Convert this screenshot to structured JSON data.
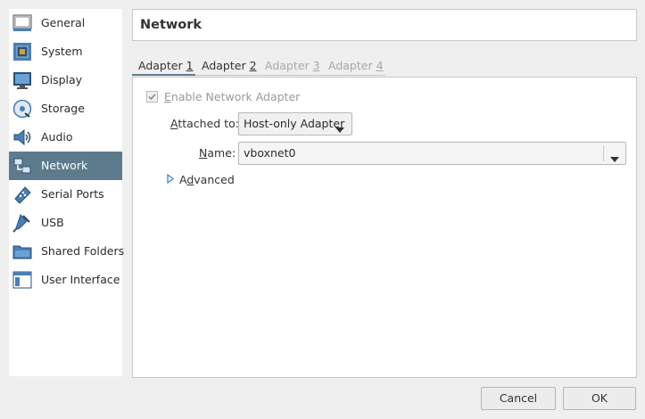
{
  "sidebar": {
    "items": [
      {
        "label": "General",
        "icon": "general-icon"
      },
      {
        "label": "System",
        "icon": "chip-icon"
      },
      {
        "label": "Display",
        "icon": "monitor-icon"
      },
      {
        "label": "Storage",
        "icon": "disk-icon"
      },
      {
        "label": "Audio",
        "icon": "speaker-icon"
      },
      {
        "label": "Network",
        "icon": "network-icon",
        "selected": true
      },
      {
        "label": "Serial Ports",
        "icon": "serial-port-icon"
      },
      {
        "label": "USB",
        "icon": "usb-icon"
      },
      {
        "label": "Shared Folders",
        "icon": "folder-icon"
      },
      {
        "label": "User Interface",
        "icon": "window-icon"
      }
    ]
  },
  "header": {
    "title": "Network"
  },
  "tabs": [
    {
      "prefix": "Adapter ",
      "mnemonic": "1",
      "enabled": true,
      "active": true
    },
    {
      "prefix": "Adapter ",
      "mnemonic": "2",
      "enabled": true
    },
    {
      "prefix": "Adapter ",
      "mnemonic": "3",
      "enabled": false
    },
    {
      "prefix": "Adapter ",
      "mnemonic": "4",
      "enabled": false
    }
  ],
  "adapter": {
    "enable": {
      "mnemonic": "E",
      "rest": "nable Network Adapter",
      "checked": true,
      "disabled": true
    },
    "attached_to": {
      "mnemonic": "A",
      "rest": "ttached to:",
      "value": "Host-only Adapter"
    },
    "name": {
      "mnemonic": "N",
      "rest": "ame:",
      "value": "vboxnet0"
    },
    "advanced": {
      "prefix": "A",
      "mnemonic": "d",
      "rest": "vanced"
    }
  },
  "buttons": {
    "cancel": "Cancel",
    "ok": "OK"
  },
  "colors": {
    "selection": "#5d7b8c",
    "background": "#efefef",
    "arrow": "#4a90d9"
  }
}
